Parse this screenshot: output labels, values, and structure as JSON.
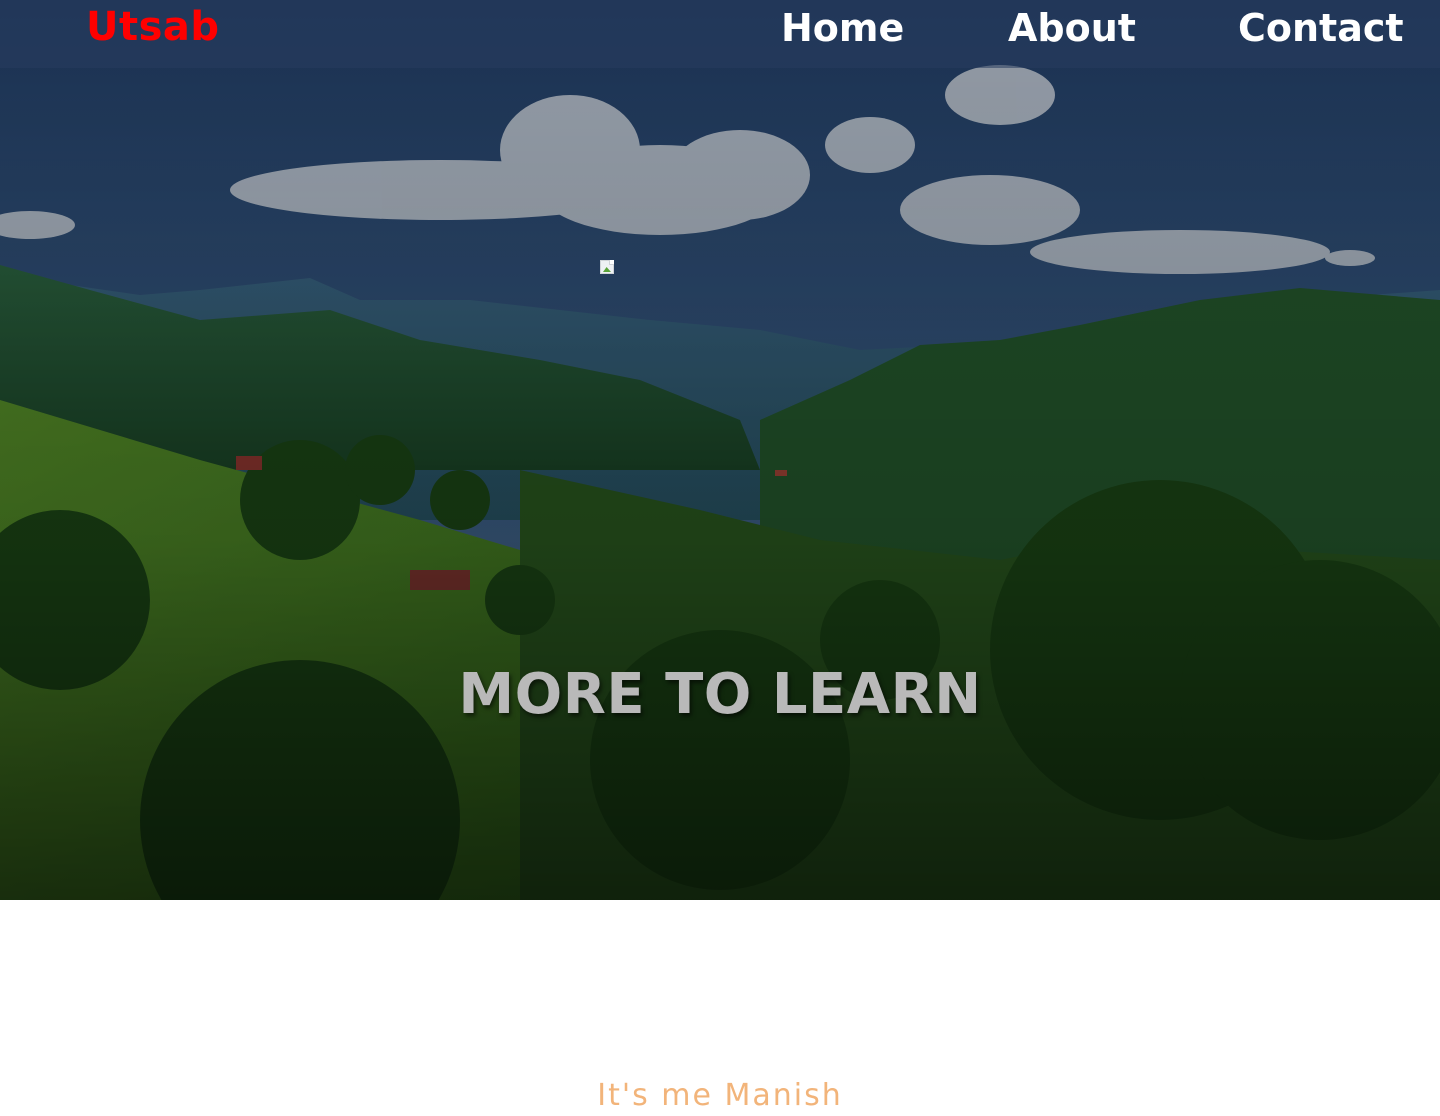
{
  "navbar": {
    "brand": "Utsab",
    "links": [
      "Home",
      "About",
      "Contact"
    ]
  },
  "hero": {
    "title": "MORE TO LEARN"
  },
  "intro": {
    "tagline": "It's me Manish"
  },
  "colors": {
    "brand": "#ff0000",
    "nav_text": "#ffffff",
    "hero_title": "#b9b9b9",
    "tagline": "#f2b47a"
  },
  "icons": {
    "broken_image": "broken-image-icon"
  }
}
